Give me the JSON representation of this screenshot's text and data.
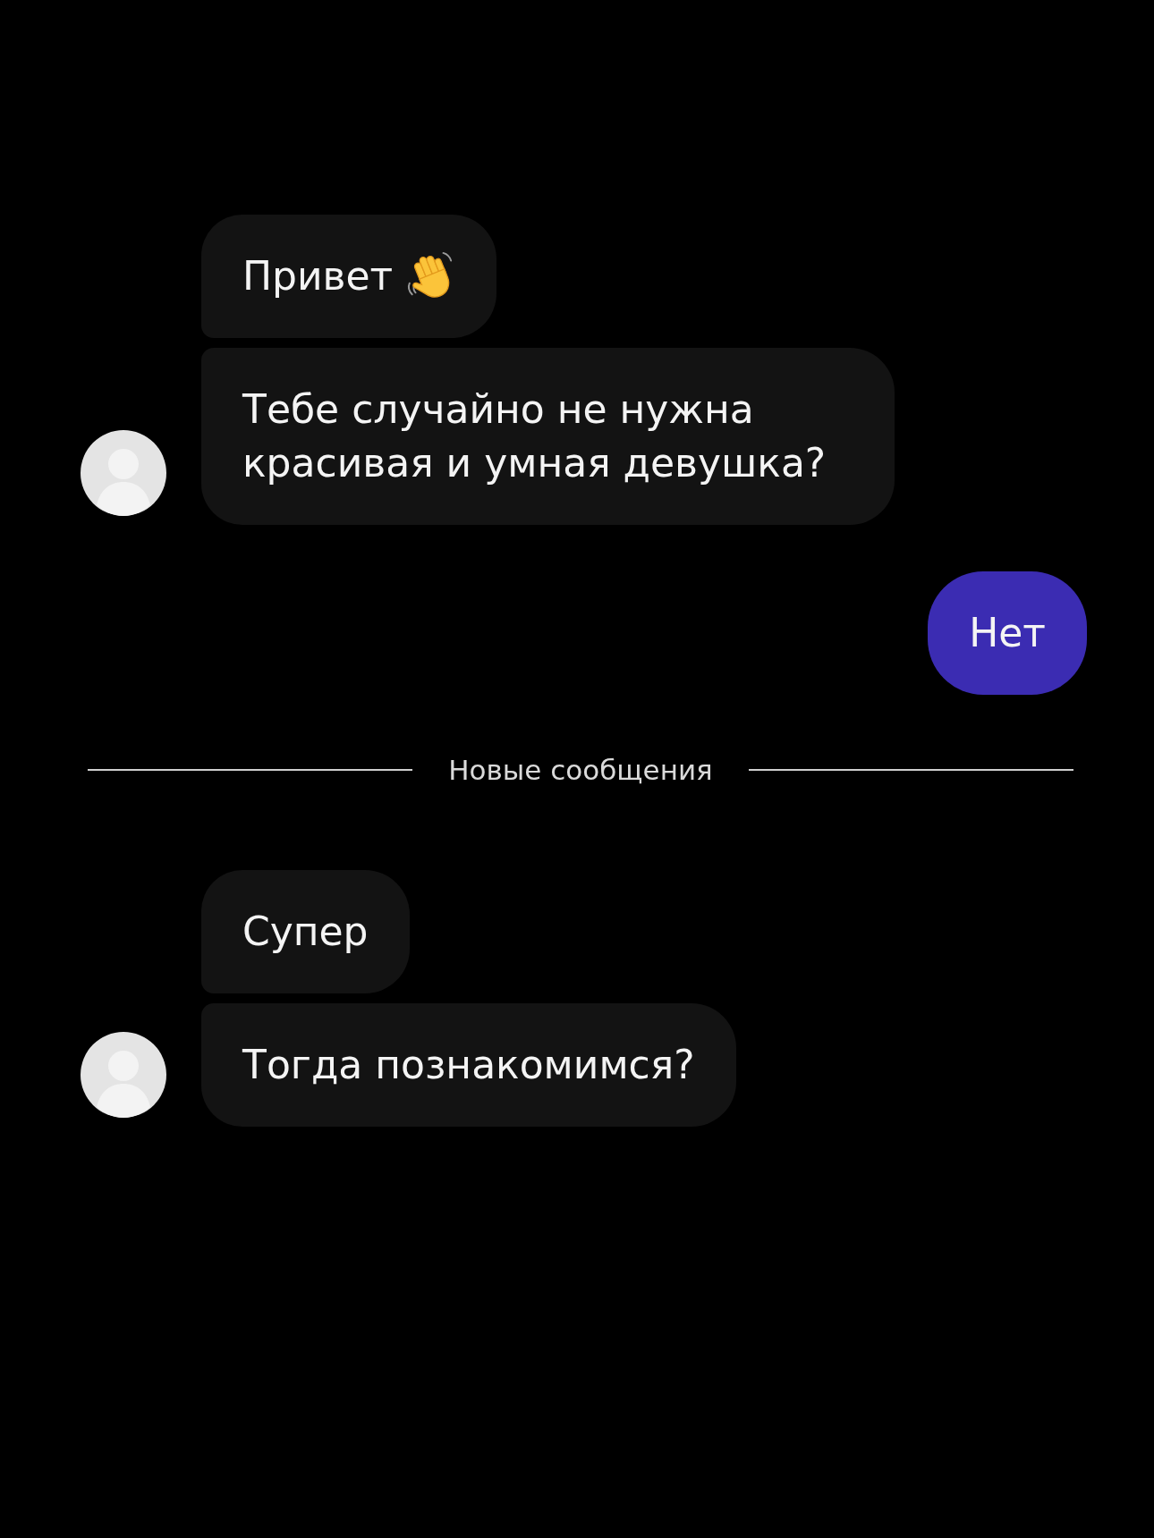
{
  "thread": [
    {
      "kind": "incoming",
      "messages": [
        {
          "text": "Привет",
          "has_icon": true
        },
        {
          "text": "Тебе случайно не нужна красивая и умная девушка?",
          "has_icon": false
        }
      ]
    },
    {
      "kind": "outgoing",
      "messages": [
        {
          "text": "Нет",
          "has_icon": false
        }
      ]
    },
    {
      "kind": "divider",
      "label": "Новые сообщения"
    },
    {
      "kind": "incoming",
      "messages": [
        {
          "text": "Супер",
          "has_icon": false
        },
        {
          "text": "Тогда познакомимся?",
          "has_icon": false
        }
      ]
    }
  ]
}
